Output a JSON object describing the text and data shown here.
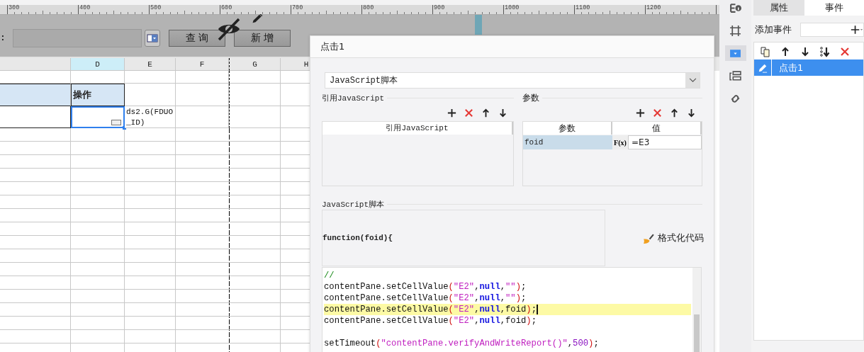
{
  "ruler": {
    "labels": [
      "300",
      "400",
      "500",
      "600",
      "700",
      "800",
      "900",
      "1000",
      "1100",
      "1200"
    ]
  },
  "form_toolbar": {
    "label": ":",
    "buttons": [
      "查 询",
      "新 增"
    ]
  },
  "sheet": {
    "columns": [
      {
        "selected": false
      },
      {
        "label": "D",
        "selected": true
      },
      {
        "label": "E",
        "selected": false
      },
      {
        "label": "F",
        "selected": false
      },
      {
        "label": "G",
        "selected": false
      },
      {
        "label": "H",
        "selected": false
      }
    ],
    "rows": [
      {
        "cells": [
          {
            "kind": "plain",
            "selected": false
          },
          {
            "kind": "plain",
            "selected": false
          },
          {
            "kind": "plain",
            "selected": false
          },
          {
            "kind": "plain",
            "selected": false
          },
          {
            "kind": "plain",
            "selected": false
          },
          {
            "kind": "plain",
            "selected": false
          }
        ]
      },
      {
        "cells": [
          {
            "kind": "header",
            "selected": false
          },
          {
            "kind": "header",
            "text": "操作",
            "selected": false
          },
          {
            "kind": "plain",
            "selected": false
          },
          {
            "kind": "plain",
            "selected": false
          },
          {
            "kind": "plain",
            "selected": false
          },
          {
            "kind": "plain",
            "selected": false
          }
        ]
      },
      {
        "cells": [
          {
            "kind": "body",
            "selected": false
          },
          {
            "kind": "body",
            "selected": true
          },
          {
            "kind": "plain",
            "text": "ds2.G(FDUO_ID)",
            "selected": false
          },
          {
            "kind": "plain",
            "selected": false
          },
          {
            "kind": "plain",
            "selected": false
          },
          {
            "kind": "plain",
            "selected": false
          }
        ]
      }
    ]
  },
  "dialog": {
    "title": "点击1",
    "type_select": {
      "value": "JavaScript脚本"
    },
    "refs": {
      "title": "引用JavaScript",
      "tools": [
        {
          "kind": "add"
        },
        {
          "kind": "delete"
        },
        {
          "kind": "up"
        },
        {
          "kind": "down"
        }
      ],
      "columns": [
        "引用JavaScript"
      ]
    },
    "params": {
      "title": "参数",
      "tools": [
        {
          "kind": "add"
        },
        {
          "kind": "delete"
        },
        {
          "kind": "up"
        },
        {
          "kind": "down"
        }
      ],
      "columns": [
        "参数",
        "值"
      ],
      "rows": [
        {
          "name": "foid",
          "formula_button": "F(x)",
          "value": "=E3"
        }
      ]
    },
    "script": {
      "title": "JavaScript脚本",
      "signature": "function(foid){",
      "format_button": "格式化代码",
      "lines": [
        {
          "current": false,
          "tokens": [
            {
              "kind": "comment",
              "text": "//"
            }
          ]
        },
        {
          "current": false,
          "tokens": [
            {
              "kind": "plain",
              "text": "contentPane.setCellValue"
            },
            {
              "kind": "paren",
              "text": "("
            },
            {
              "kind": "string",
              "text": "\"E2\""
            },
            {
              "kind": "plain",
              "text": ","
            },
            {
              "kind": "keyword",
              "text": "null"
            },
            {
              "kind": "plain",
              "text": ","
            },
            {
              "kind": "string",
              "text": "\"\""
            },
            {
              "kind": "paren",
              "text": ")"
            },
            {
              "kind": "plain",
              "text": ";"
            }
          ]
        },
        {
          "current": false,
          "tokens": [
            {
              "kind": "plain",
              "text": "contentPane.setCellValue"
            },
            {
              "kind": "paren",
              "text": "("
            },
            {
              "kind": "string",
              "text": "\"E2\""
            },
            {
              "kind": "plain",
              "text": ","
            },
            {
              "kind": "keyword",
              "text": "null"
            },
            {
              "kind": "plain",
              "text": ","
            },
            {
              "kind": "string",
              "text": "\"\""
            },
            {
              "kind": "paren",
              "text": ")"
            },
            {
              "kind": "plain",
              "text": ";"
            }
          ]
        },
        {
          "current": true,
          "tokens": [
            {
              "kind": "plain",
              "text": "contentPane.setCellValue"
            },
            {
              "kind": "paren",
              "text": "("
            },
            {
              "kind": "string",
              "text": "\"E2\""
            },
            {
              "kind": "plain",
              "text": ","
            },
            {
              "kind": "keyword",
              "text": "null"
            },
            {
              "kind": "plain",
              "text": ",foid"
            },
            {
              "kind": "paren",
              "text": ")"
            },
            {
              "kind": "plain",
              "text": ";"
            }
          ]
        },
        {
          "current": false,
          "tokens": [
            {
              "kind": "plain",
              "text": "contentPane.setCellValue"
            },
            {
              "kind": "paren",
              "text": "("
            },
            {
              "kind": "string",
              "text": "\"E2\""
            },
            {
              "kind": "plain",
              "text": ","
            },
            {
              "kind": "keyword",
              "text": "null"
            },
            {
              "kind": "plain",
              "text": ",foid"
            },
            {
              "kind": "paren",
              "text": ")"
            },
            {
              "kind": "plain",
              "text": ";"
            }
          ]
        },
        {
          "gap_before": true,
          "current": false,
          "tokens": [
            {
              "kind": "plain",
              "text": "setTimeout"
            },
            {
              "kind": "paren",
              "text": "("
            },
            {
              "kind": "string",
              "text": "\"contentPane.verifyAndWriteReport()\""
            },
            {
              "kind": "plain",
              "text": ","
            },
            {
              "kind": "number",
              "text": "500"
            },
            {
              "kind": "paren",
              "text": ")"
            },
            {
              "kind": "plain",
              "text": ";"
            }
          ]
        }
      ]
    }
  },
  "icon_strip": [
    {
      "kind": "info",
      "selected": false
    },
    {
      "kind": "frame",
      "selected": false
    },
    {
      "kind": "dropdown",
      "selected": true
    },
    {
      "kind": "layout",
      "selected": false
    },
    {
      "kind": "link",
      "selected": false
    }
  ],
  "panel": {
    "tabs": [
      {
        "label": "属性",
        "selected": false
      },
      {
        "label": "事件",
        "selected": true
      }
    ],
    "add_label": "添加事件",
    "tools": [
      {
        "kind": "copy"
      },
      {
        "kind": "up"
      },
      {
        "kind": "down"
      },
      {
        "kind": "bottom"
      },
      {
        "kind": "delete"
      }
    ],
    "events": [
      {
        "label": "点击1",
        "selected": true
      }
    ]
  }
}
